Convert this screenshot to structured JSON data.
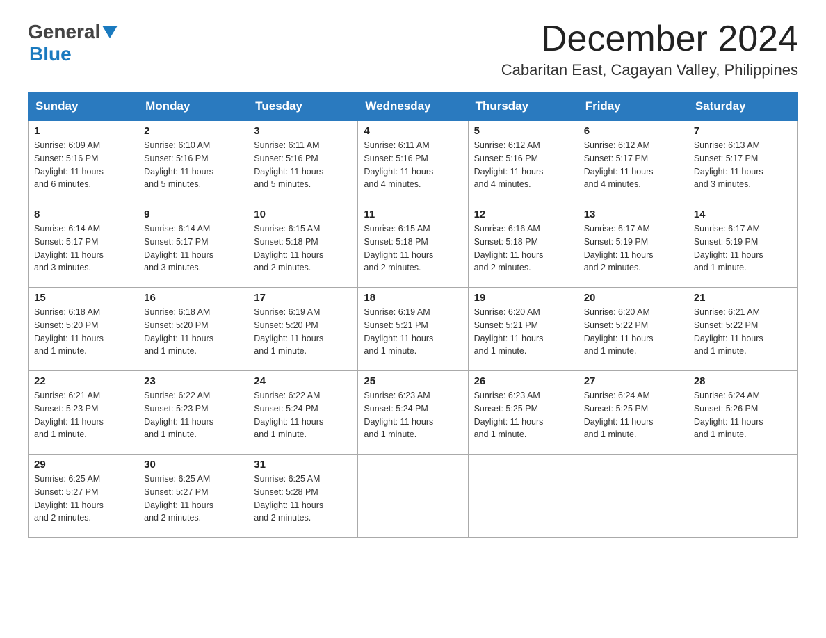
{
  "header": {
    "logo_text_general": "General",
    "logo_text_blue": "Blue",
    "month_title": "December 2024",
    "location": "Cabaritan East, Cagayan Valley, Philippines"
  },
  "days_of_week": [
    "Sunday",
    "Monday",
    "Tuesday",
    "Wednesday",
    "Thursday",
    "Friday",
    "Saturday"
  ],
  "weeks": [
    [
      {
        "day": "1",
        "sunrise": "6:09 AM",
        "sunset": "5:16 PM",
        "daylight": "11 hours and 6 minutes."
      },
      {
        "day": "2",
        "sunrise": "6:10 AM",
        "sunset": "5:16 PM",
        "daylight": "11 hours and 5 minutes."
      },
      {
        "day": "3",
        "sunrise": "6:11 AM",
        "sunset": "5:16 PM",
        "daylight": "11 hours and 5 minutes."
      },
      {
        "day": "4",
        "sunrise": "6:11 AM",
        "sunset": "5:16 PM",
        "daylight": "11 hours and 4 minutes."
      },
      {
        "day": "5",
        "sunrise": "6:12 AM",
        "sunset": "5:16 PM",
        "daylight": "11 hours and 4 minutes."
      },
      {
        "day": "6",
        "sunrise": "6:12 AM",
        "sunset": "5:17 PM",
        "daylight": "11 hours and 4 minutes."
      },
      {
        "day": "7",
        "sunrise": "6:13 AM",
        "sunset": "5:17 PM",
        "daylight": "11 hours and 3 minutes."
      }
    ],
    [
      {
        "day": "8",
        "sunrise": "6:14 AM",
        "sunset": "5:17 PM",
        "daylight": "11 hours and 3 minutes."
      },
      {
        "day": "9",
        "sunrise": "6:14 AM",
        "sunset": "5:17 PM",
        "daylight": "11 hours and 3 minutes."
      },
      {
        "day": "10",
        "sunrise": "6:15 AM",
        "sunset": "5:18 PM",
        "daylight": "11 hours and 2 minutes."
      },
      {
        "day": "11",
        "sunrise": "6:15 AM",
        "sunset": "5:18 PM",
        "daylight": "11 hours and 2 minutes."
      },
      {
        "day": "12",
        "sunrise": "6:16 AM",
        "sunset": "5:18 PM",
        "daylight": "11 hours and 2 minutes."
      },
      {
        "day": "13",
        "sunrise": "6:17 AM",
        "sunset": "5:19 PM",
        "daylight": "11 hours and 2 minutes."
      },
      {
        "day": "14",
        "sunrise": "6:17 AM",
        "sunset": "5:19 PM",
        "daylight": "11 hours and 1 minute."
      }
    ],
    [
      {
        "day": "15",
        "sunrise": "6:18 AM",
        "sunset": "5:20 PM",
        "daylight": "11 hours and 1 minute."
      },
      {
        "day": "16",
        "sunrise": "6:18 AM",
        "sunset": "5:20 PM",
        "daylight": "11 hours and 1 minute."
      },
      {
        "day": "17",
        "sunrise": "6:19 AM",
        "sunset": "5:20 PM",
        "daylight": "11 hours and 1 minute."
      },
      {
        "day": "18",
        "sunrise": "6:19 AM",
        "sunset": "5:21 PM",
        "daylight": "11 hours and 1 minute."
      },
      {
        "day": "19",
        "sunrise": "6:20 AM",
        "sunset": "5:21 PM",
        "daylight": "11 hours and 1 minute."
      },
      {
        "day": "20",
        "sunrise": "6:20 AM",
        "sunset": "5:22 PM",
        "daylight": "11 hours and 1 minute."
      },
      {
        "day": "21",
        "sunrise": "6:21 AM",
        "sunset": "5:22 PM",
        "daylight": "11 hours and 1 minute."
      }
    ],
    [
      {
        "day": "22",
        "sunrise": "6:21 AM",
        "sunset": "5:23 PM",
        "daylight": "11 hours and 1 minute."
      },
      {
        "day": "23",
        "sunrise": "6:22 AM",
        "sunset": "5:23 PM",
        "daylight": "11 hours and 1 minute."
      },
      {
        "day": "24",
        "sunrise": "6:22 AM",
        "sunset": "5:24 PM",
        "daylight": "11 hours and 1 minute."
      },
      {
        "day": "25",
        "sunrise": "6:23 AM",
        "sunset": "5:24 PM",
        "daylight": "11 hours and 1 minute."
      },
      {
        "day": "26",
        "sunrise": "6:23 AM",
        "sunset": "5:25 PM",
        "daylight": "11 hours and 1 minute."
      },
      {
        "day": "27",
        "sunrise": "6:24 AM",
        "sunset": "5:25 PM",
        "daylight": "11 hours and 1 minute."
      },
      {
        "day": "28",
        "sunrise": "6:24 AM",
        "sunset": "5:26 PM",
        "daylight": "11 hours and 1 minute."
      }
    ],
    [
      {
        "day": "29",
        "sunrise": "6:25 AM",
        "sunset": "5:27 PM",
        "daylight": "11 hours and 2 minutes."
      },
      {
        "day": "30",
        "sunrise": "6:25 AM",
        "sunset": "5:27 PM",
        "daylight": "11 hours and 2 minutes."
      },
      {
        "day": "31",
        "sunrise": "6:25 AM",
        "sunset": "5:28 PM",
        "daylight": "11 hours and 2 minutes."
      },
      null,
      null,
      null,
      null
    ]
  ],
  "labels": {
    "sunrise": "Sunrise:",
    "sunset": "Sunset:",
    "daylight": "Daylight:"
  }
}
